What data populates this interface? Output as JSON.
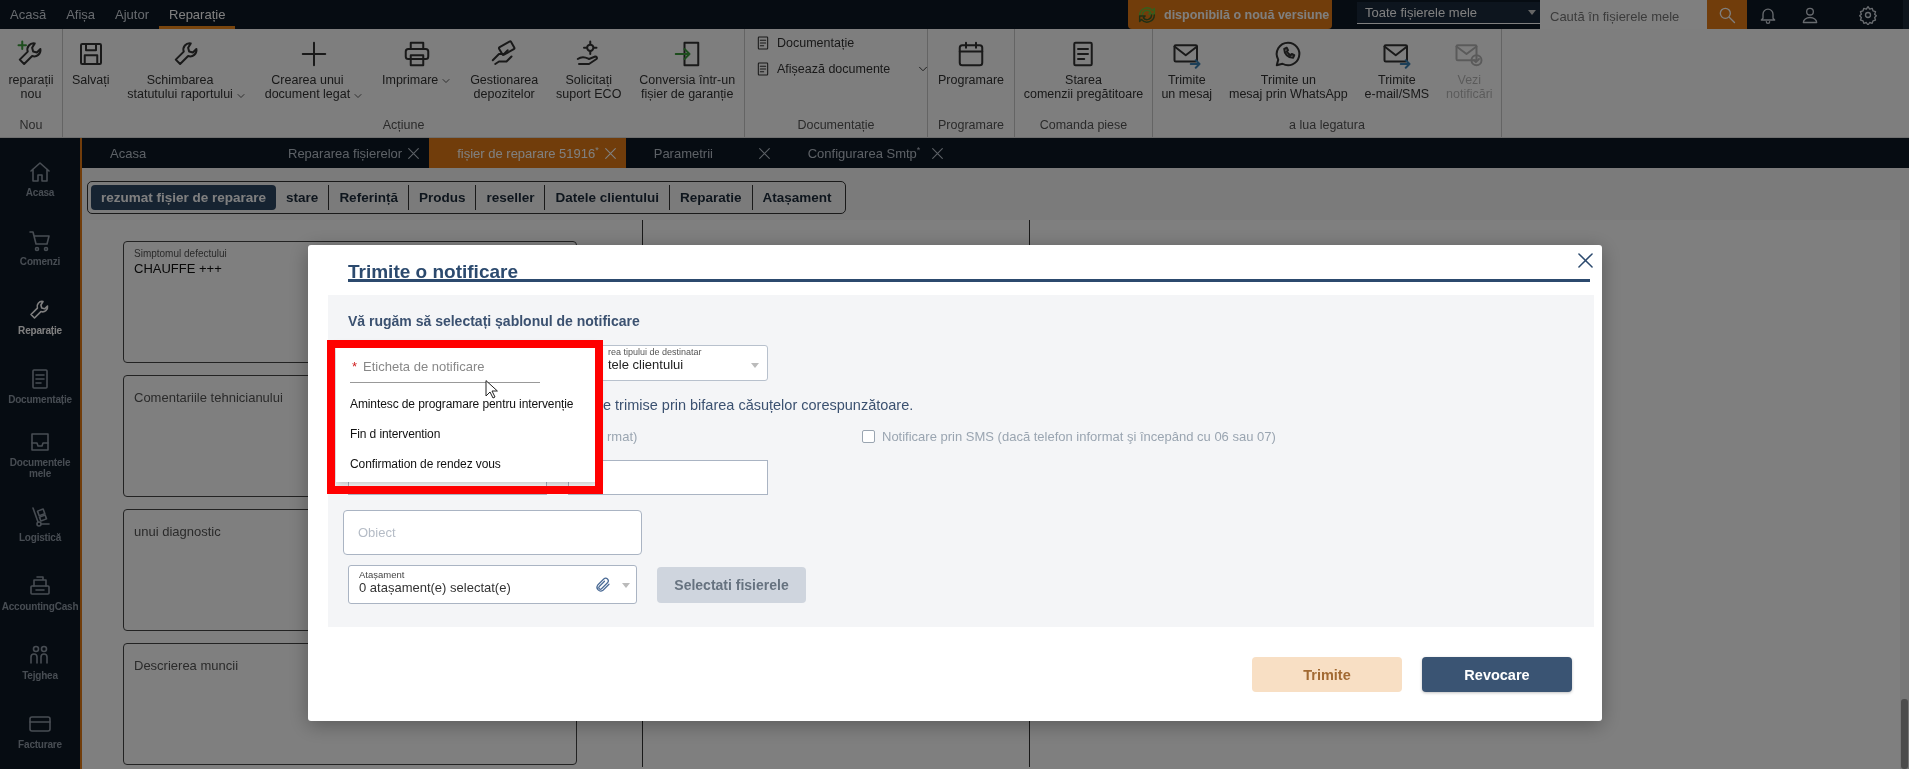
{
  "menu_bar": {
    "items": [
      {
        "label": "Acasă",
        "selected": false
      },
      {
        "label": "Afișa",
        "selected": false
      },
      {
        "label": "Ajutor",
        "selected": false
      },
      {
        "label": "Reparație",
        "selected": true
      }
    ],
    "update_badge": "disponibilă o nouă versiune",
    "scope_select": "Toate fișierele mele",
    "search": {
      "placeholder": "Caută în fișierele mele"
    }
  },
  "ribbon": {
    "groups": [
      {
        "title": "Nou",
        "kind": "large",
        "items": [
          {
            "label": "reparații\nnou",
            "dropdown": false,
            "disabled": false
          }
        ]
      },
      {
        "title": "Acțiune",
        "kind": "large",
        "items": [
          {
            "label": "Salvați",
            "dropdown": false,
            "disabled": false
          },
          {
            "label": "Schimbarea\nstatutului raportului",
            "dropdown": true,
            "disabled": false
          },
          {
            "label": "Crearea unui\ndocument legat",
            "dropdown": true,
            "disabled": false
          },
          {
            "label": "Imprimare",
            "dropdown": true,
            "disabled": false
          },
          {
            "label": "Gestionarea\ndepozitelor",
            "dropdown": false,
            "disabled": false
          },
          {
            "label": "Solicitați\nsuport ECO",
            "dropdown": false,
            "disabled": false
          },
          {
            "label": "Conversia într-un\nfișier de garanție",
            "dropdown": false,
            "disabled": false
          }
        ]
      },
      {
        "title": "Documentație",
        "kind": "small",
        "items": [
          {
            "label": "Documentație",
            "dropdown": false,
            "disabled": false
          },
          {
            "label": "Afișează documente",
            "dropdown": true,
            "disabled": false
          }
        ]
      },
      {
        "title": "Programare",
        "kind": "large",
        "items": [
          {
            "label": "Programare",
            "dropdown": false,
            "disabled": false
          }
        ]
      },
      {
        "title": "Comanda piese",
        "kind": "large",
        "items": [
          {
            "label": "Starea\ncomenzii pregătitoare",
            "dropdown": false,
            "disabled": false
          }
        ]
      },
      {
        "title": "a lua legatura",
        "kind": "large",
        "items": [
          {
            "label": "Trimite\nun mesaj",
            "dropdown": false,
            "disabled": false
          },
          {
            "label": "Trimite un\nmesaj prin WhatsApp",
            "dropdown": false,
            "disabled": false
          },
          {
            "label": "Trimite\ne-mail/SMS",
            "dropdown": false,
            "disabled": false
          },
          {
            "label": "Vezi\nnotificări",
            "dropdown": false,
            "disabled": true
          }
        ]
      }
    ]
  },
  "sidebar": {
    "items": [
      {
        "label": "Acasa",
        "selected": false
      },
      {
        "label": "Comenzi",
        "selected": false
      },
      {
        "label": "Reparație",
        "selected": true
      },
      {
        "label": "Documentație",
        "selected": false
      },
      {
        "label": "Documentele\nmele",
        "selected": false
      },
      {
        "label": "Logistică",
        "selected": false
      },
      {
        "label": "AccountingCash",
        "selected": false
      },
      {
        "label": "Tejghea",
        "selected": false
      },
      {
        "label": "Facturare",
        "selected": false
      }
    ]
  },
  "doc_tabs": [
    {
      "label": "Acasa",
      "selected": false,
      "closable": false
    },
    {
      "label": "Repararea fișierelor",
      "selected": false,
      "closable": true
    },
    {
      "label": "fișier de reparare 51916$^{*}$",
      "selected": true,
      "closable": true
    },
    {
      "label": "Parametrii",
      "selected": false,
      "closable": true
    },
    {
      "label": "Configurarea Smtp$^{*}$",
      "selected": false,
      "closable": true
    }
  ],
  "section_tabs": [
    {
      "label": "rezumat fișier de reparare",
      "selected": true
    },
    {
      "label": "stare",
      "selected": false
    },
    {
      "label": "Referință",
      "selected": false
    },
    {
      "label": "Produs",
      "selected": false
    },
    {
      "label": "reseller",
      "selected": false
    },
    {
      "label": "Datele clientului",
      "selected": false
    },
    {
      "label": "Reparatie",
      "selected": false
    },
    {
      "label": "Atașament",
      "selected": false
    }
  ],
  "repair_form": {
    "fields": [
      {
        "label": "Simptomul defectului",
        "value": "CHAUFFE +++"
      },
      {
        "placeholder": "Comentariile tehnicianului"
      },
      {
        "placeholder": "unui diagnostic"
      },
      {
        "placeholder": "Descrierea muncii"
      }
    ]
  },
  "dialog": {
    "title": "Trimite o notificare",
    "prompt": "Vă rugăm să selectați șablonul de notificare",
    "template_field": {
      "required_mark": "*",
      "placeholder": "Eticheta de notificare",
      "options": [
        "Amintesc de programare pentru intervenție",
        "Fin d intervention",
        "Confirmation de rendez vous"
      ]
    },
    "recipient_select": {
      "label": "rea tipului de destinatar",
      "value": "tele clientului"
    },
    "channels_hint": "e trimise prin bifarea căsuțelor corespunzătoare.",
    "email_option_tail": "rmat)",
    "sms_option": {
      "label": "Notificare prin SMS (dacă telefon informat şi începând cu 06 sau 07)",
      "checked": false
    },
    "subject_field": {
      "placeholder": "Obiect"
    },
    "attachment_field": {
      "label": "Atașament",
      "value": "0 atașament(e) selectat(e)"
    },
    "select_files_button": {
      "label": "Selectati fisierele",
      "disabled": true
    },
    "buttons": [
      {
        "label": "Trimite",
        "kind": "primary",
        "disabled": true
      },
      {
        "label": "Revocare",
        "kind": "secondary",
        "disabled": false
      }
    ]
  }
}
